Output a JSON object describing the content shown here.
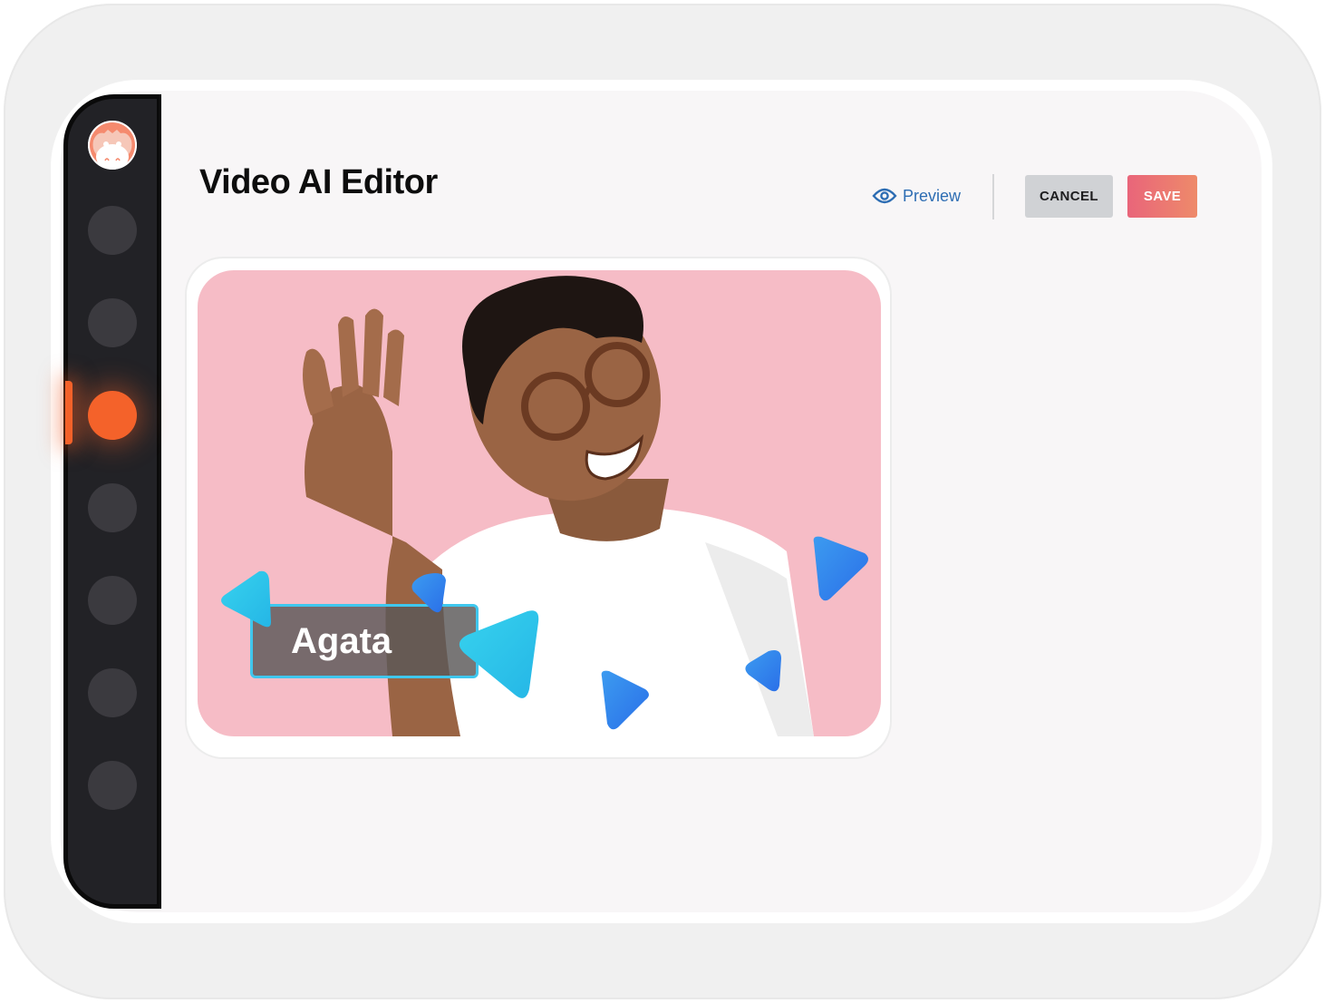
{
  "header": {
    "title": "Video AI Editor",
    "preview_label": "Preview",
    "cancel_label": "CANCEL",
    "save_label": "SAVE"
  },
  "sidebar": {
    "items": [
      {
        "name": "nav-1",
        "active": false
      },
      {
        "name": "nav-2",
        "active": false
      },
      {
        "name": "nav-3",
        "active": true
      },
      {
        "name": "nav-4",
        "active": false
      },
      {
        "name": "nav-5",
        "active": false
      },
      {
        "name": "nav-6",
        "active": false
      },
      {
        "name": "nav-7",
        "active": false
      }
    ]
  },
  "video": {
    "name_tag": "Agata"
  },
  "colors": {
    "accent": "#f4622a",
    "link": "#2d6db3",
    "save_gradient_start": "#e9657a",
    "save_gradient_end": "#ee8a6a",
    "cancel_bg": "#d0d2d5",
    "sidebar_bg": "#222226",
    "tag_border": "#3fc7ee",
    "video_bg": "#f6bcc6"
  },
  "icons": {
    "avatar": "mascot-icon",
    "preview": "eye-icon",
    "decorations": "play-triangle-icon"
  }
}
